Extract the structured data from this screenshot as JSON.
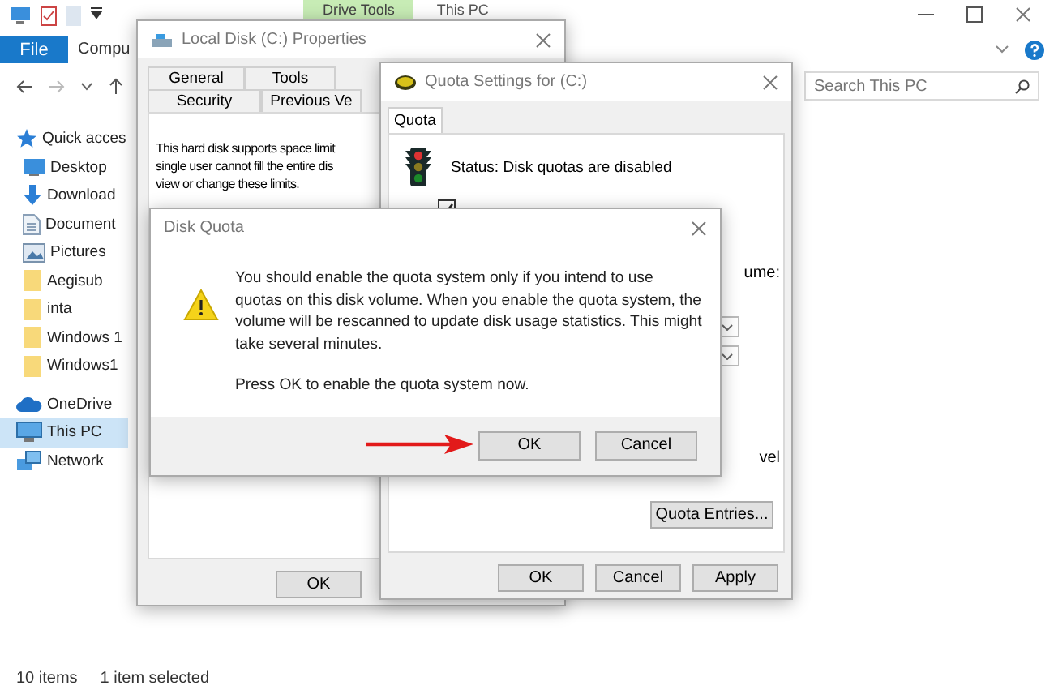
{
  "explorer": {
    "title": "This PC",
    "context_tab": "Drive Tools",
    "ribbon_tabs": [
      {
        "label": "File",
        "selected": true
      },
      {
        "label": "Compu",
        "selected": false
      }
    ],
    "search": {
      "placeholder": "Search This PC"
    },
    "sidebar": [
      {
        "label": "Quick acces",
        "kind": "star",
        "selected": false,
        "children": [
          {
            "label": "Desktop",
            "kind": "desktop",
            "selected": false
          },
          {
            "label": "Download",
            "kind": "download",
            "selected": false
          },
          {
            "label": "Document",
            "kind": "document",
            "selected": false
          },
          {
            "label": "Pictures",
            "kind": "pictures",
            "selected": false
          },
          {
            "label": "Aegisub",
            "kind": "folder",
            "selected": false
          },
          {
            "label": "inta",
            "kind": "folder",
            "selected": false
          },
          {
            "label": "Windows 1",
            "kind": "folder",
            "selected": false
          },
          {
            "label": "Windows1",
            "kind": "folder",
            "selected": false
          }
        ]
      },
      {
        "label": "OneDrive",
        "kind": "cloud",
        "selected": false
      },
      {
        "label": "This PC",
        "kind": "pc",
        "selected": true
      },
      {
        "label": "Network",
        "kind": "network",
        "selected": false
      }
    ],
    "status_bar": [
      "10 items",
      "1 item selected"
    ]
  },
  "properties_window": {
    "title": "Local Disk (C:) Properties",
    "tab_rows": [
      [
        {
          "label": "General",
          "selected": false
        },
        {
          "label": "Tools",
          "selected": false
        }
      ],
      [
        {
          "label": "Security",
          "selected": false
        },
        {
          "label": "Previous Ve",
          "selected": false
        }
      ]
    ],
    "description": [
      "This hard disk supports space limit",
      "single user cannot fill the entire dis",
      "view or change these limits."
    ],
    "buttons": [
      "OK"
    ]
  },
  "quota_window": {
    "title": "Quota Settings for  (C:)",
    "tabs": [
      {
        "label": "Quota",
        "selected": true
      }
    ],
    "status": "Status:  Disk quotas are disabled",
    "enable_checkbox": {
      "checked": true
    },
    "label_fragments": [
      "ume:",
      "vel"
    ],
    "quota_entries_button": "Quota Entries...",
    "buttons": [
      "OK",
      "Cancel",
      "Apply"
    ]
  },
  "dialog": {
    "title": "Disk Quota",
    "message": "You should enable the quota system only if you intend to use quotas on this disk volume.  When you enable the quota system, the volume will be rescanned to update disk usage statistics. This might take several minutes.",
    "prompt": "Press OK to enable the quota system now.",
    "buttons": [
      "OK",
      "Cancel"
    ]
  }
}
